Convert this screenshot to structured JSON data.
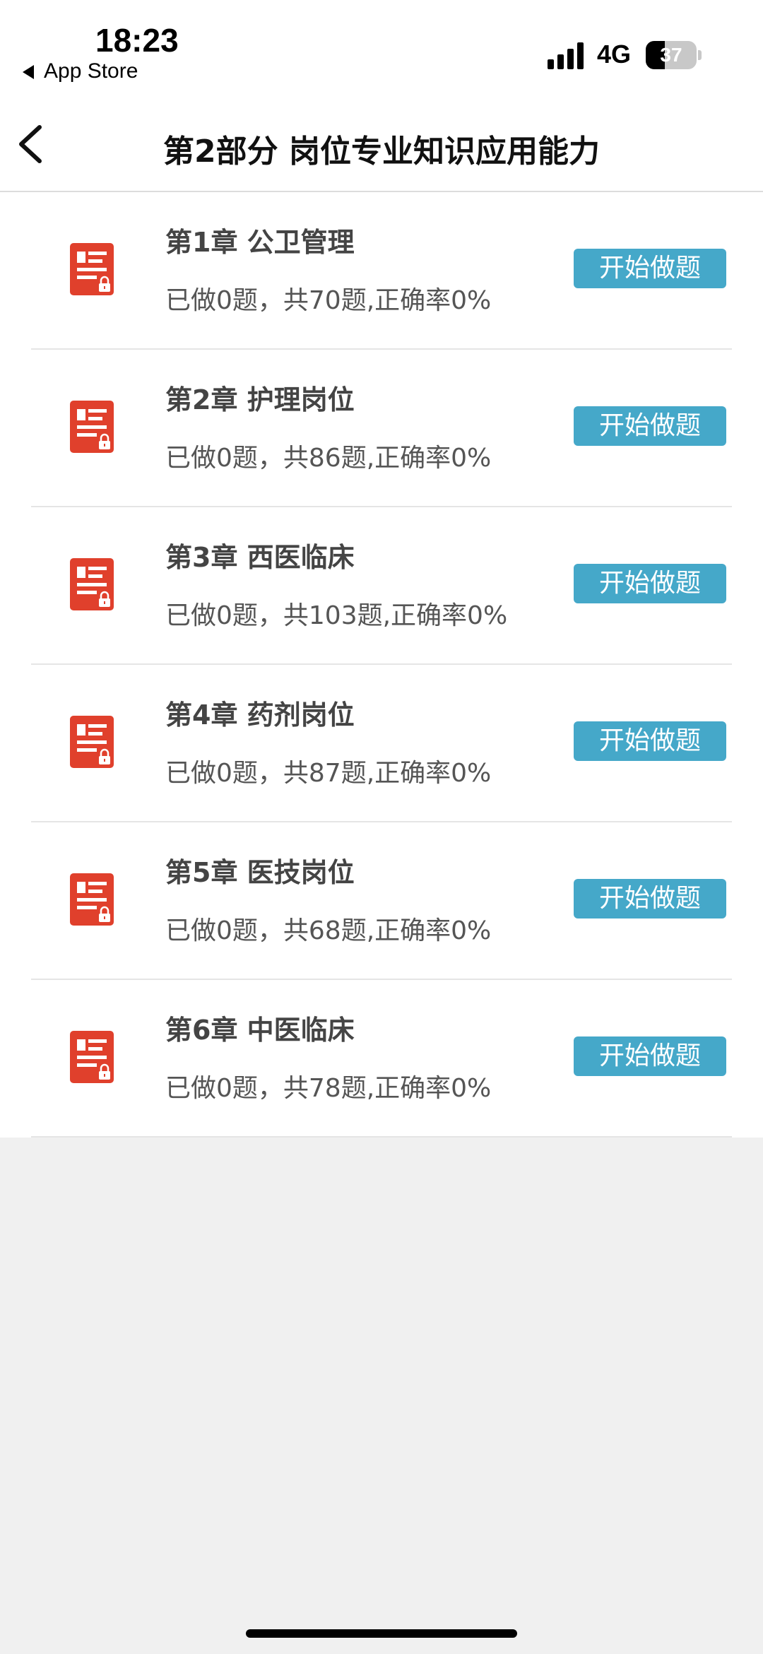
{
  "status_bar": {
    "time": "18:23",
    "back_app": "App Store",
    "network": "4G",
    "battery": "37",
    "battery_level": 0.37
  },
  "nav": {
    "title": "第2部分 岗位专业知识应用能力"
  },
  "chapters": [
    {
      "title": "第1章 公卫管理",
      "progress": "已做0题，共70题,正确率0%",
      "button": "开始做题"
    },
    {
      "title": "第2章 护理岗位",
      "progress": "已做0题，共86题,正确率0%",
      "button": "开始做题"
    },
    {
      "title": "第3章 西医临床",
      "progress": "已做0题，共103题,正确率0%",
      "button": "开始做题"
    },
    {
      "title": "第4章 药剂岗位",
      "progress": "已做0题，共87题,正确率0%",
      "button": "开始做题"
    },
    {
      "title": "第5章 医技岗位",
      "progress": "已做0题，共68题,正确率0%",
      "button": "开始做题"
    },
    {
      "title": "第6章 中医临床",
      "progress": "已做0题，共78题,正确率0%",
      "button": "开始做题"
    }
  ],
  "icons": {
    "chapter_icon": "locked-document-icon",
    "back": "chevron-left-icon"
  },
  "colors": {
    "button": "#45a8c9",
    "icon": "#e0402c"
  }
}
